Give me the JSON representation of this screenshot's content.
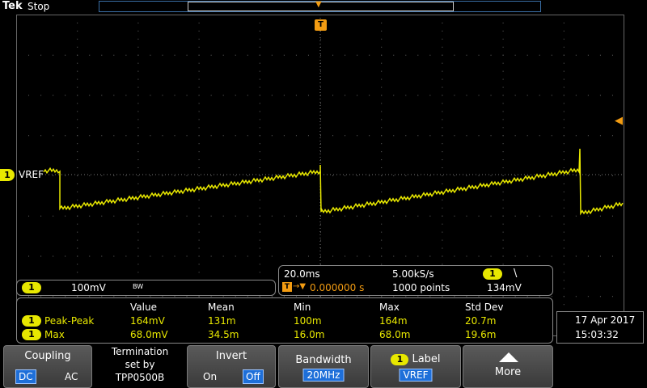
{
  "top": {
    "brand": "Tek",
    "run_state": "Stop"
  },
  "channel": {
    "number": "1",
    "ref_label": "VREF",
    "scale": "100mV",
    "bw_icon": "BW"
  },
  "timebase": {
    "scale": "20.0ms",
    "sample_rate": "5.00kS/s",
    "delay": "0.000000 s",
    "record_length": "1000 points",
    "trigger_channel": "1",
    "trigger_slope": "\\",
    "trigger_level": "134mV",
    "trigger_icon": "T"
  },
  "measurements": {
    "headers": [
      "Value",
      "Mean",
      "Min",
      "Max",
      "Std Dev"
    ],
    "rows": [
      {
        "name": "Peak-Peak",
        "values": [
          "164mV",
          "131m",
          "100m",
          "164m",
          "20.7m"
        ]
      },
      {
        "name": "Max",
        "values": [
          "68.0mV",
          "34.5m",
          "16.0m",
          "68.0m",
          "19.6m"
        ]
      }
    ]
  },
  "datetime": {
    "date": "17 Apr  2017",
    "time": "15:03:32"
  },
  "menu": {
    "coupling": {
      "title": "Coupling",
      "opt1": "DC",
      "opt2": "AC",
      "selected": "DC"
    },
    "termination": {
      "line1": "Termination",
      "line2": "set by",
      "line3": "TPP0500B"
    },
    "invert": {
      "title": "Invert",
      "opt1": "On",
      "opt2": "Off",
      "selected": "Off"
    },
    "bandwidth": {
      "title": "Bandwidth",
      "value": "20MHz"
    },
    "label": {
      "title": "Label",
      "value": "VREF"
    },
    "more": {
      "title": "More",
      "icon": "up-triangle-icon"
    }
  },
  "colors": {
    "ch1": "#e8e800",
    "trigger": "#f39c12",
    "accent": "#1e6fd9",
    "grid": "#555555"
  }
}
